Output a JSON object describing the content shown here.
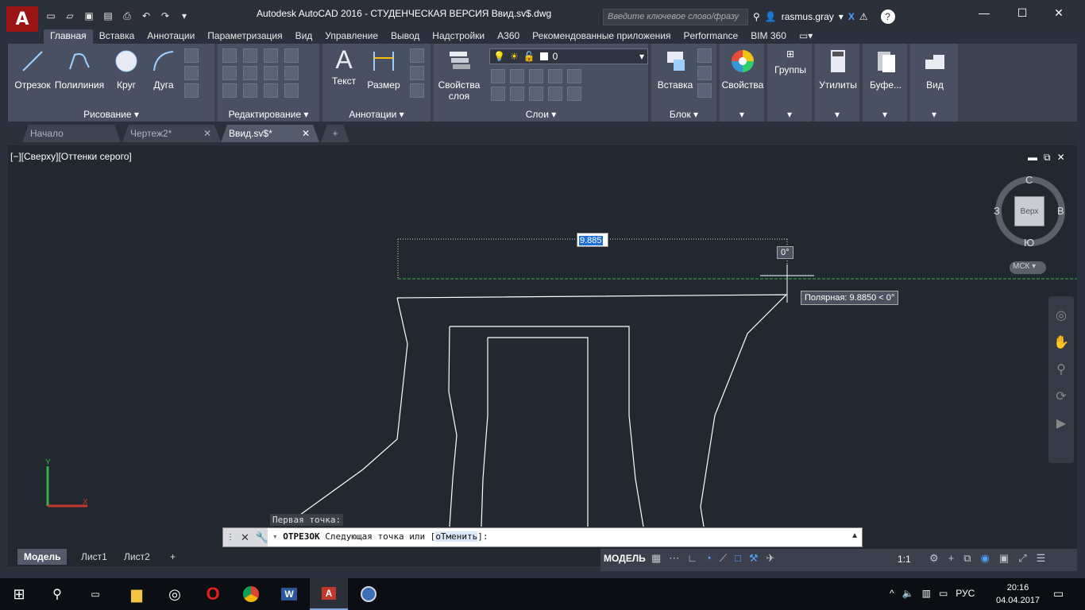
{
  "window": {
    "title": "Autodesk AutoCAD 2016 - СТУДЕНЧЕСКАЯ ВЕРСИЯ     Ввид.sv$.dwg",
    "search_placeholder": "Введите ключевое слово/фразу",
    "user": "rasmus.gray"
  },
  "ribbon_tabs": [
    "Главная",
    "Вставка",
    "Аннотации",
    "Параметризация",
    "Вид",
    "Управление",
    "Вывод",
    "Надстройки",
    "A360",
    "Рекомендованные приложения",
    "Performance",
    "BIM 360"
  ],
  "panels": {
    "draw": {
      "title": "Рисование",
      "line": "Отрезок",
      "polyline": "Полилиния",
      "circle": "Круг",
      "arc": "Дуга"
    },
    "modify": {
      "title": "Редактирование"
    },
    "annotation": {
      "title": "Аннотации",
      "text": "Текст",
      "dimension": "Размер"
    },
    "layers": {
      "title": "Слои",
      "props": "Свойства\nслоя",
      "props_l1": "Свойства",
      "props_l2": "слоя",
      "current_layer": "0"
    },
    "block": {
      "title": "Блок",
      "insert": "Вставка"
    },
    "properties": {
      "label": "Свойства"
    },
    "groups": {
      "label": "Группы"
    },
    "utilities": {
      "label": "Утилиты"
    },
    "clipboard": {
      "label": "Буфе..."
    },
    "view": {
      "label": "Вид"
    }
  },
  "doc_tabs": [
    "Начало",
    "Чертеж2*",
    "Ввид.sv$*"
  ],
  "viewport": {
    "label": "[−][Сверху][Оттенки серого]",
    "dyn_input_value": "9.885",
    "angle_tooltip": "0°",
    "polar_tooltip": "Полярная: 9.8850 < 0°",
    "viewcube": {
      "top": "Верх",
      "north": "С",
      "south": "Ю",
      "east": "В",
      "west": "З",
      "ucs": "МСК"
    }
  },
  "command": {
    "history": "Первая точка:",
    "command_name": "ОТРЕЗОК",
    "prompt": "Следующая точка или [",
    "option": "оТменить",
    "prompt_end": "]:"
  },
  "layout_tabs": [
    "Модель",
    "Лист1",
    "Лист2"
  ],
  "status": {
    "model": "МОДЕЛЬ",
    "scale": "1:1"
  },
  "taskbar": {
    "time": "20:16",
    "date": "04.04.2017",
    "lang": "РУС"
  }
}
